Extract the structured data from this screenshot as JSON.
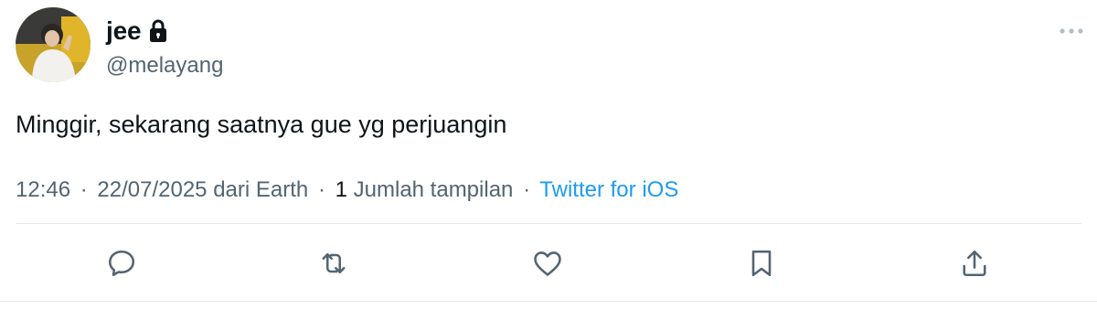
{
  "user": {
    "display_name": "jee",
    "handle": "@melayang",
    "protected": true,
    "avatar_icon": "profile-photo"
  },
  "tweet": {
    "text": "Minggir, sekarang saatnya gue yg perjuangin"
  },
  "meta": {
    "time": "12:46",
    "date": "22/07/2025",
    "location": "dari Earth",
    "views_count": "1",
    "views_label": "Jumlah tampilan",
    "source": "Twitter for iOS",
    "separator": "·"
  },
  "icons": {
    "more": "more-horizontal-icon",
    "reply": "reply-bubble-icon",
    "retweet": "retweet-icon",
    "like": "heart-icon",
    "bookmark": "bookmark-icon",
    "share": "share-upload-icon",
    "lock": "lock-icon"
  },
  "colors": {
    "text": "#0f1419",
    "secondary": "#536471",
    "link": "#1d9bf0",
    "icon": "#536471",
    "divider": "#e6e9ec"
  }
}
